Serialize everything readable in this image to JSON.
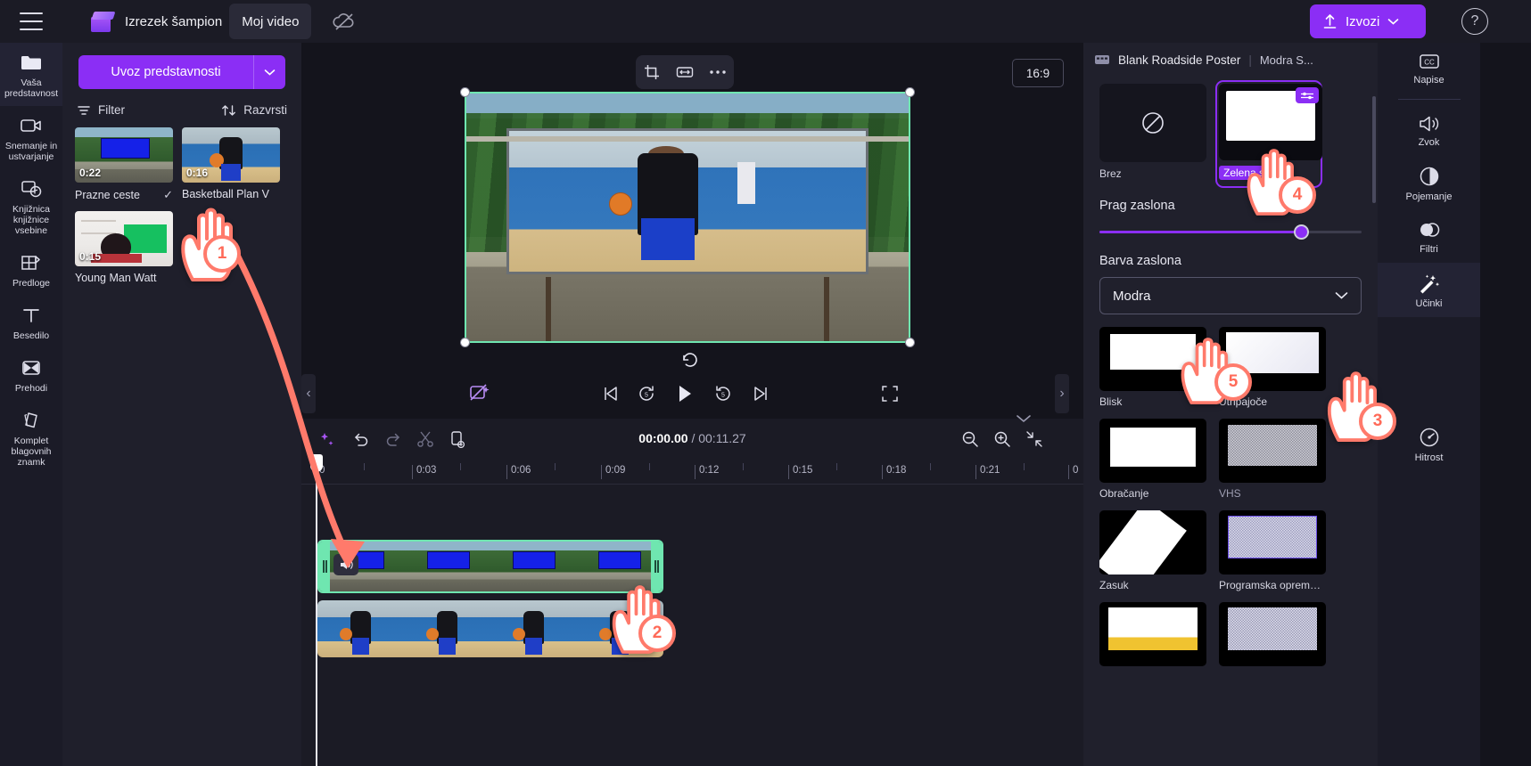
{
  "topbar": {
    "menu_icon": "hamburger-icon",
    "app_logo": "clipchamp-logo",
    "project_title": "Izrezek šampion",
    "name_field_value": "Moj video",
    "cloud_icon": "cloud-off-icon",
    "export_label": "Izvozi",
    "export_caret": "chevron-down-icon",
    "help_icon": "question-mark-icon",
    "accent": "#8b2ef5"
  },
  "left_rail": {
    "items": [
      {
        "label": "Vaša predstavnost",
        "icon": "folder-icon",
        "active": true
      },
      {
        "label": "Snemanje in ustvarjanje",
        "icon": "video-camera-icon",
        "active": false
      },
      {
        "label": "Knjižnica knjižnice vsebine",
        "icon": "content-library-icon",
        "active": false
      },
      {
        "label": "Predloge",
        "icon": "templates-icon",
        "active": false
      },
      {
        "label": "Besedilo",
        "icon": "text-icon",
        "active": false
      },
      {
        "label": "Prehodi",
        "icon": "transitions-icon",
        "active": false
      },
      {
        "label": "Komplet blagovnih znamk",
        "icon": "brand-kit-icon",
        "active": false
      }
    ]
  },
  "media_panel": {
    "import_label": "Uvoz predstavnosti",
    "import_caret": "chevron-down-icon",
    "filter_label": "Filter",
    "sort_label": "Razvrsti",
    "items": [
      {
        "name": "Prazne ceste",
        "duration": "0:22",
        "art": "art-road",
        "checked": true
      },
      {
        "name": "Basketball Plan V",
        "duration": "0:16",
        "art": "art-court",
        "checked": false
      },
      {
        "name": "Young Man Watt",
        "duration": "0:15",
        "art": "art-room",
        "checked": false
      }
    ]
  },
  "preview": {
    "tools": [
      "crop-icon",
      "fit-icon",
      "more-options-icon"
    ],
    "ratio": "16:9",
    "rotate_icon": "rotate-icon",
    "magic_icon": "remove-background-icon",
    "controls": [
      "skip-to-start-icon",
      "rewind-5-icon",
      "play-icon",
      "forward-5-icon",
      "skip-to-end-icon"
    ],
    "fullscreen_icon": "fullscreen-icon",
    "left_arrow": "chevron-left-icon",
    "right_arrow": "chevron-right-icon"
  },
  "timeline": {
    "toolbar_icons": [
      "magic-wand-icon",
      "undo-icon",
      "redo-icon",
      "split-icon",
      "duplicate-icon"
    ],
    "current_time": "00:00.00",
    "separator": "/",
    "total_time": "00:11.27",
    "zoom_out_icon": "zoom-out-icon",
    "zoom_in_icon": "zoom-in-icon",
    "fit-icon": "fit-timeline-icon",
    "collapse_icon": "chevron-down-icon",
    "ruler_ticks": [
      "0",
      "0:03",
      "0:06",
      "0:09",
      "0:12",
      "0:15",
      "0:18",
      "0:21",
      "0"
    ],
    "tracks": [
      {
        "name": "track-video-1",
        "art": "art-road",
        "selected": true,
        "speaker_icon": "speaker-icon"
      },
      {
        "name": "track-video-2",
        "art": "art-court",
        "selected": false
      }
    ]
  },
  "effects_panel": {
    "clip_icon": "film-strip-icon",
    "clip_name": "Blank Roadside Poster",
    "sub_name": "Modra S...",
    "screen_options": [
      {
        "label": "Brez",
        "icon": "no-effect-icon",
        "selected": false
      },
      {
        "label": "Zelena s",
        "icon": "green-screen-icon",
        "selected": true,
        "badge": "sliders-icon"
      }
    ],
    "threshold_label": "Prag zaslona",
    "threshold_value": 74,
    "screen_color_label": "Barva zaslona",
    "screen_color_value": "Modra",
    "screen_color_caret": "chevron-down-icon",
    "effects": [
      {
        "label": "Blisk",
        "art": "art-flash",
        "dim": false
      },
      {
        "label": "Utripajoče",
        "art": "art-pulse",
        "dim": false
      },
      {
        "label": "Obračanje",
        "art": "art-rot",
        "dim": false
      },
      {
        "label": "VHS",
        "art": "art-noise",
        "dim": true
      },
      {
        "label": "Zasuk",
        "art": "art-tilt",
        "dim": false
      },
      {
        "label": "Programska oprema za uparjalnik",
        "art": "art-glitch",
        "dim": false
      },
      {
        "label": "",
        "art": "art-last1",
        "dim": false
      },
      {
        "label": "",
        "art": "art-last2",
        "dim": false
      }
    ]
  },
  "tool_rail": {
    "items": [
      {
        "label": "Napise",
        "icon": "captions-icon",
        "active": false,
        "divider_after": true
      },
      {
        "label": "Zvok",
        "icon": "audio-icon",
        "active": false
      },
      {
        "label": "Pojemanje",
        "icon": "fade-icon",
        "active": false
      },
      {
        "label": "Filtri",
        "icon": "filters-icon",
        "active": false
      },
      {
        "label": "Učinki",
        "icon": "effects-icon",
        "active": true
      },
      {
        "label": "Hitrost",
        "icon": "speed-icon",
        "active": false
      }
    ]
  },
  "annotations": {
    "steps": [
      {
        "number": "1",
        "target": "media-item-basketball"
      },
      {
        "number": "2",
        "target": "timeline-track-1"
      },
      {
        "number": "3",
        "target": "tool-rail-effects"
      },
      {
        "number": "4",
        "target": "green-screen-option"
      },
      {
        "number": "5",
        "target": "screen-color-select"
      }
    ],
    "arrow_color": "#ff7a6b"
  }
}
